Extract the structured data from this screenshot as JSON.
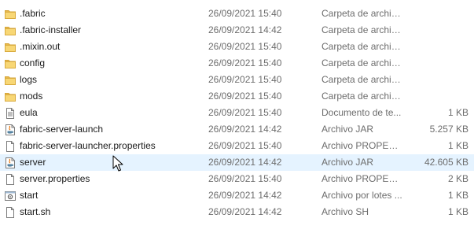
{
  "files": [
    {
      "name": ".fabric",
      "date": "26/09/2021 15:40",
      "type": "Carpeta de archivos",
      "size": "",
      "icon": "folder-icon"
    },
    {
      "name": ".fabric-installer",
      "date": "26/09/2021 14:42",
      "type": "Carpeta de archivos",
      "size": "",
      "icon": "folder-icon"
    },
    {
      "name": ".mixin.out",
      "date": "26/09/2021 15:40",
      "type": "Carpeta de archivos",
      "size": "",
      "icon": "folder-icon"
    },
    {
      "name": "config",
      "date": "26/09/2021 15:40",
      "type": "Carpeta de archivos",
      "size": "",
      "icon": "folder-icon"
    },
    {
      "name": "logs",
      "date": "26/09/2021 15:40",
      "type": "Carpeta de archivos",
      "size": "",
      "icon": "folder-icon"
    },
    {
      "name": "mods",
      "date": "26/09/2021 15:40",
      "type": "Carpeta de archivos",
      "size": "",
      "icon": "folder-icon"
    },
    {
      "name": "eula",
      "date": "26/09/2021 15:40",
      "type": "Documento de te...",
      "size": "1 KB",
      "icon": "text-document-icon"
    },
    {
      "name": "fabric-server-launch",
      "date": "26/09/2021 14:42",
      "type": "Archivo JAR",
      "size": "5.257 KB",
      "icon": "java-jar-icon"
    },
    {
      "name": "fabric-server-launcher.properties",
      "date": "26/09/2021 15:40",
      "type": "Archivo PROPERTI...",
      "size": "1 KB",
      "icon": "blank-file-icon"
    },
    {
      "name": "server",
      "date": "26/09/2021 14:42",
      "type": "Archivo JAR",
      "size": "42.605 KB",
      "icon": "java-jar-icon"
    },
    {
      "name": "server.properties",
      "date": "26/09/2021 15:40",
      "type": "Archivo PROPERTI...",
      "size": "2 KB",
      "icon": "blank-file-icon"
    },
    {
      "name": "start",
      "date": "26/09/2021 14:42",
      "type": "Archivo por lotes ...",
      "size": "1 KB",
      "icon": "batch-file-icon"
    },
    {
      "name": "start.sh",
      "date": "26/09/2021 14:42",
      "type": "Archivo SH",
      "size": "1 KB",
      "icon": "blank-file-icon"
    }
  ],
  "hovered_index": 9,
  "colors": {
    "folder": "#f8d775",
    "hover": "#e5f3ff",
    "secondary_text": "#6d6d6d"
  }
}
